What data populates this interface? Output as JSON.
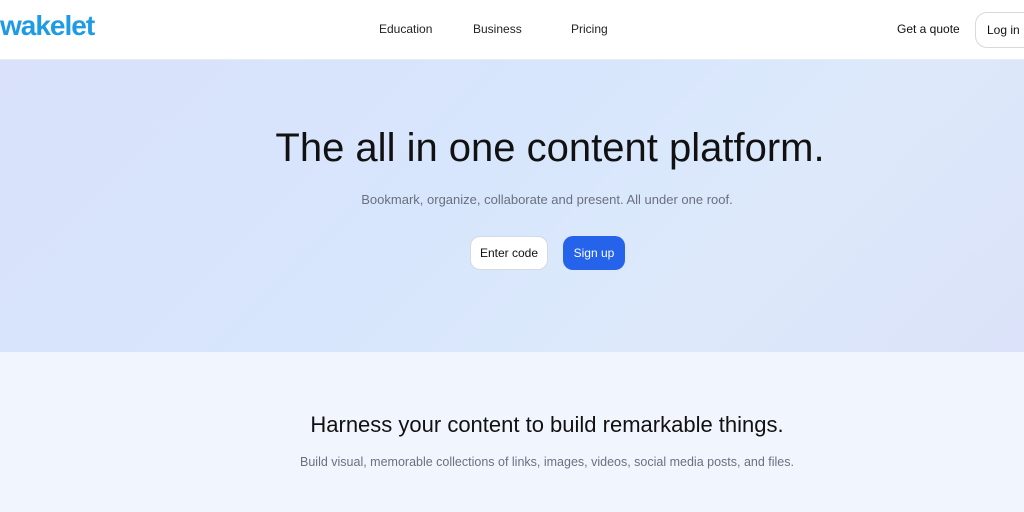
{
  "header": {
    "logo": "wakelet",
    "nav": [
      "Education",
      "Business",
      "Pricing"
    ],
    "quote_label": "Get a quote",
    "login_label": "Log in"
  },
  "hero": {
    "title": "The all in one content platform.",
    "subtitle": "Bookmark, organize, collaborate and present. All under one roof.",
    "enter_code_label": "Enter code",
    "signup_label": "Sign up"
  },
  "section2": {
    "title": "Harness your content to build remarkable things.",
    "subtitle": "Build visual, memorable collections of links, images, videos, social media posts, and files."
  },
  "colors": {
    "brand": "#1f9be6",
    "accent": "#2563eb"
  }
}
